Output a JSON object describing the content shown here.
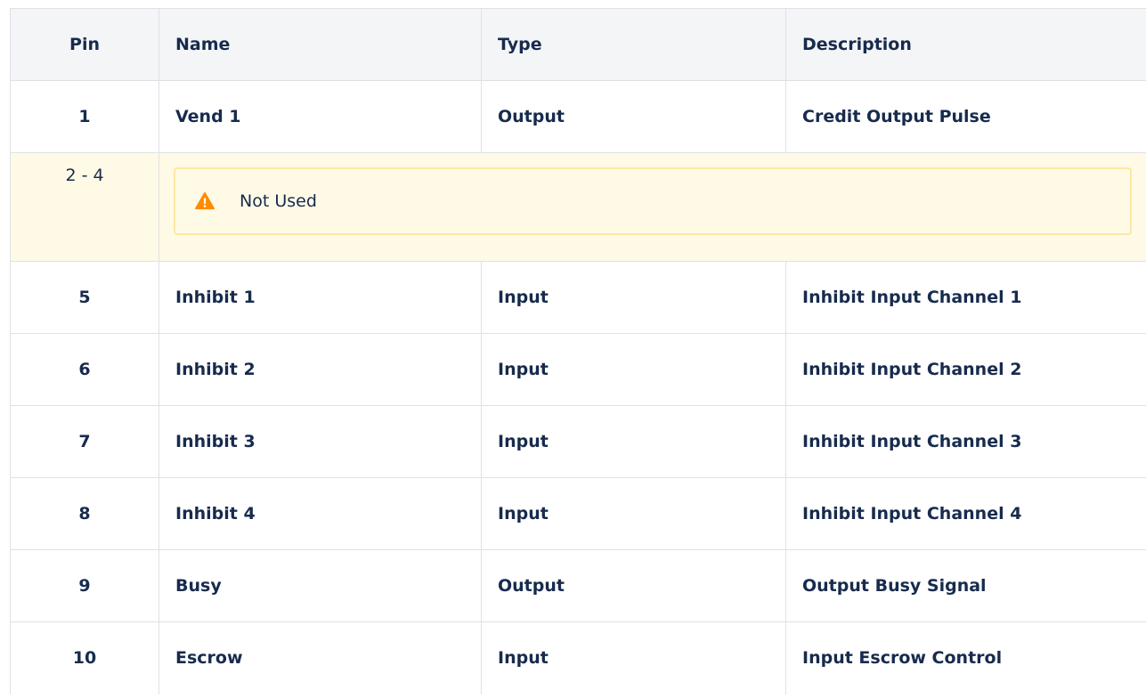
{
  "header": {
    "pin": "Pin",
    "name": "Name",
    "type": "Type",
    "description": "Description"
  },
  "rows": [
    {
      "pin": "1",
      "name": "Vend 1",
      "type": "Output",
      "description": "Credit Output Pulse"
    },
    {
      "pin": "2 - 4",
      "note": "Not Used",
      "icon": "warning-icon",
      "accent": "#ff8b00"
    },
    {
      "pin": "5",
      "name": "Inhibit 1",
      "type": "Input",
      "description": "Inhibit Input Channel 1"
    },
    {
      "pin": "6",
      "name": "Inhibit 2",
      "type": "Input",
      "description": "Inhibit Input Channel 2"
    },
    {
      "pin": "7",
      "name": "Inhibit 3",
      "type": "Input",
      "description": "Inhibit Input Channel 3"
    },
    {
      "pin": "8",
      "name": "Inhibit 4",
      "type": "Input",
      "description": "Inhibit Input Channel 4"
    },
    {
      "pin": "9",
      "name": "Busy",
      "type": "Output",
      "description": "Output Busy Signal"
    },
    {
      "pin": "10",
      "name": "Escrow",
      "type": "Input",
      "description": "Input Escrow Control"
    }
  ]
}
